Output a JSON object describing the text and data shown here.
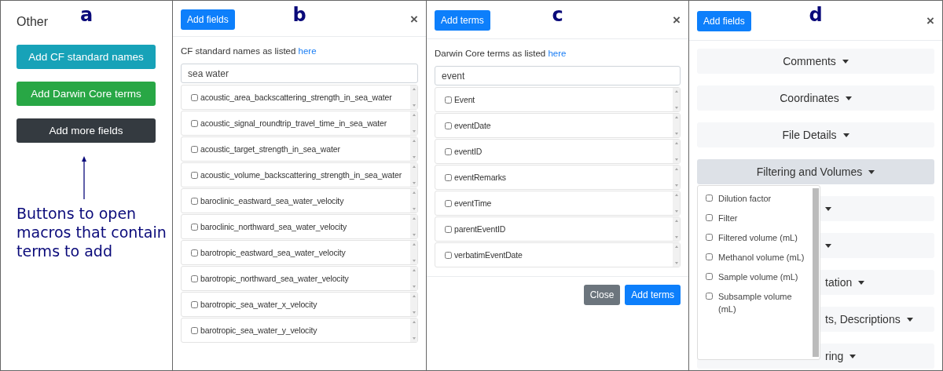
{
  "panels": [
    {
      "letter": "a",
      "title": "Other",
      "buttons": [
        {
          "label": "Add CF standard names",
          "color": "#17a2b8"
        },
        {
          "label": "Add Darwin Core terms",
          "color": "#28a745"
        },
        {
          "label": "Add more fields",
          "color": "#343a40"
        }
      ],
      "annotation": "Buttons to open macros that contain terms to add"
    },
    {
      "letter": "b",
      "header_button": "Add fields",
      "close": "×",
      "intro": "CF standard names as listed ",
      "intro_link": "here",
      "search": {
        "value": "sea water"
      },
      "items": [
        {
          "label": "acoustic_area_backscattering_strength_in_sea_water",
          "checked": false
        },
        {
          "label": "acoustic_signal_roundtrip_travel_time_in_sea_water",
          "checked": false
        },
        {
          "label": "acoustic_target_strength_in_sea_water",
          "checked": false
        },
        {
          "label": "acoustic_volume_backscattering_strength_in_sea_water",
          "checked": false
        },
        {
          "label": "baroclinic_eastward_sea_water_velocity",
          "checked": false
        },
        {
          "label": "baroclinic_northward_sea_water_velocity",
          "checked": false
        },
        {
          "label": "barotropic_eastward_sea_water_velocity",
          "checked": false
        },
        {
          "label": "barotropic_northward_sea_water_velocity",
          "checked": false
        },
        {
          "label": "barotropic_sea_water_x_velocity",
          "checked": false
        },
        {
          "label": "barotropic_sea_water_y_velocity",
          "checked": false
        }
      ]
    },
    {
      "letter": "c",
      "header_button": "Add terms",
      "close": "×",
      "intro": "Darwin Core terms as listed ",
      "intro_link": "here",
      "search": {
        "value": "event"
      },
      "items": [
        {
          "label": "Event",
          "checked": false
        },
        {
          "label": "eventDate",
          "checked": false
        },
        {
          "label": "eventID",
          "checked": false
        },
        {
          "label": "eventRemarks",
          "checked": false
        },
        {
          "label": "eventTime",
          "checked": false
        },
        {
          "label": "parentEventID",
          "checked": false
        },
        {
          "label": "verbatimEventDate",
          "checked": false
        }
      ],
      "footer": [
        "Close",
        "Add terms"
      ]
    },
    {
      "letter": "d",
      "header_button": "Add fields",
      "close": "×",
      "sections": [
        {
          "label": "Comments",
          "kind": "full",
          "selected": false
        },
        {
          "label": "Coordinates",
          "kind": "full",
          "selected": false
        },
        {
          "label": "File Details",
          "kind": "full",
          "selected": false
        },
        {
          "label": "Filtering and Volumes",
          "kind": "full",
          "selected": true
        },
        {
          "kind": "partial",
          "selected": false
        },
        {
          "kind": "partial",
          "selected": false
        },
        {
          "label": "tation",
          "kind": "partial",
          "selected": false
        },
        {
          "label": "ts, Descriptions",
          "kind": "partial",
          "selected": false
        },
        {
          "label": "ring",
          "kind": "partial",
          "selected": false
        }
      ],
      "dropdown": [
        {
          "label": "Dilution factor",
          "checked": false
        },
        {
          "label": "Filter",
          "checked": false
        },
        {
          "label": "Filtered volume (mL)",
          "checked": false
        },
        {
          "label": "Methanol volume (mL)",
          "checked": false
        },
        {
          "label": "Sample volume (mL)",
          "checked": false
        },
        {
          "label": "Subsample volume (mL)",
          "checked": false
        }
      ]
    }
  ]
}
